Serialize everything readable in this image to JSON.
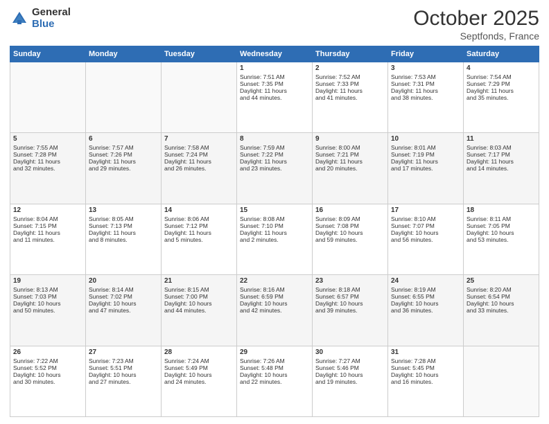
{
  "header": {
    "logo_general": "General",
    "logo_blue": "Blue",
    "month": "October 2025",
    "location": "Septfonds, France"
  },
  "weekdays": [
    "Sunday",
    "Monday",
    "Tuesday",
    "Wednesday",
    "Thursday",
    "Friday",
    "Saturday"
  ],
  "rows": [
    [
      {
        "day": "",
        "info": ""
      },
      {
        "day": "",
        "info": ""
      },
      {
        "day": "",
        "info": ""
      },
      {
        "day": "1",
        "info": "Sunrise: 7:51 AM\nSunset: 7:35 PM\nDaylight: 11 hours\nand 44 minutes."
      },
      {
        "day": "2",
        "info": "Sunrise: 7:52 AM\nSunset: 7:33 PM\nDaylight: 11 hours\nand 41 minutes."
      },
      {
        "day": "3",
        "info": "Sunrise: 7:53 AM\nSunset: 7:31 PM\nDaylight: 11 hours\nand 38 minutes."
      },
      {
        "day": "4",
        "info": "Sunrise: 7:54 AM\nSunset: 7:29 PM\nDaylight: 11 hours\nand 35 minutes."
      }
    ],
    [
      {
        "day": "5",
        "info": "Sunrise: 7:55 AM\nSunset: 7:28 PM\nDaylight: 11 hours\nand 32 minutes."
      },
      {
        "day": "6",
        "info": "Sunrise: 7:57 AM\nSunset: 7:26 PM\nDaylight: 11 hours\nand 29 minutes."
      },
      {
        "day": "7",
        "info": "Sunrise: 7:58 AM\nSunset: 7:24 PM\nDaylight: 11 hours\nand 26 minutes."
      },
      {
        "day": "8",
        "info": "Sunrise: 7:59 AM\nSunset: 7:22 PM\nDaylight: 11 hours\nand 23 minutes."
      },
      {
        "day": "9",
        "info": "Sunrise: 8:00 AM\nSunset: 7:21 PM\nDaylight: 11 hours\nand 20 minutes."
      },
      {
        "day": "10",
        "info": "Sunrise: 8:01 AM\nSunset: 7:19 PM\nDaylight: 11 hours\nand 17 minutes."
      },
      {
        "day": "11",
        "info": "Sunrise: 8:03 AM\nSunset: 7:17 PM\nDaylight: 11 hours\nand 14 minutes."
      }
    ],
    [
      {
        "day": "12",
        "info": "Sunrise: 8:04 AM\nSunset: 7:15 PM\nDaylight: 11 hours\nand 11 minutes."
      },
      {
        "day": "13",
        "info": "Sunrise: 8:05 AM\nSunset: 7:13 PM\nDaylight: 11 hours\nand 8 minutes."
      },
      {
        "day": "14",
        "info": "Sunrise: 8:06 AM\nSunset: 7:12 PM\nDaylight: 11 hours\nand 5 minutes."
      },
      {
        "day": "15",
        "info": "Sunrise: 8:08 AM\nSunset: 7:10 PM\nDaylight: 11 hours\nand 2 minutes."
      },
      {
        "day": "16",
        "info": "Sunrise: 8:09 AM\nSunset: 7:08 PM\nDaylight: 10 hours\nand 59 minutes."
      },
      {
        "day": "17",
        "info": "Sunrise: 8:10 AM\nSunset: 7:07 PM\nDaylight: 10 hours\nand 56 minutes."
      },
      {
        "day": "18",
        "info": "Sunrise: 8:11 AM\nSunset: 7:05 PM\nDaylight: 10 hours\nand 53 minutes."
      }
    ],
    [
      {
        "day": "19",
        "info": "Sunrise: 8:13 AM\nSunset: 7:03 PM\nDaylight: 10 hours\nand 50 minutes."
      },
      {
        "day": "20",
        "info": "Sunrise: 8:14 AM\nSunset: 7:02 PM\nDaylight: 10 hours\nand 47 minutes."
      },
      {
        "day": "21",
        "info": "Sunrise: 8:15 AM\nSunset: 7:00 PM\nDaylight: 10 hours\nand 44 minutes."
      },
      {
        "day": "22",
        "info": "Sunrise: 8:16 AM\nSunset: 6:59 PM\nDaylight: 10 hours\nand 42 minutes."
      },
      {
        "day": "23",
        "info": "Sunrise: 8:18 AM\nSunset: 6:57 PM\nDaylight: 10 hours\nand 39 minutes."
      },
      {
        "day": "24",
        "info": "Sunrise: 8:19 AM\nSunset: 6:55 PM\nDaylight: 10 hours\nand 36 minutes."
      },
      {
        "day": "25",
        "info": "Sunrise: 8:20 AM\nSunset: 6:54 PM\nDaylight: 10 hours\nand 33 minutes."
      }
    ],
    [
      {
        "day": "26",
        "info": "Sunrise: 7:22 AM\nSunset: 5:52 PM\nDaylight: 10 hours\nand 30 minutes."
      },
      {
        "day": "27",
        "info": "Sunrise: 7:23 AM\nSunset: 5:51 PM\nDaylight: 10 hours\nand 27 minutes."
      },
      {
        "day": "28",
        "info": "Sunrise: 7:24 AM\nSunset: 5:49 PM\nDaylight: 10 hours\nand 24 minutes."
      },
      {
        "day": "29",
        "info": "Sunrise: 7:26 AM\nSunset: 5:48 PM\nDaylight: 10 hours\nand 22 minutes."
      },
      {
        "day": "30",
        "info": "Sunrise: 7:27 AM\nSunset: 5:46 PM\nDaylight: 10 hours\nand 19 minutes."
      },
      {
        "day": "31",
        "info": "Sunrise: 7:28 AM\nSunset: 5:45 PM\nDaylight: 10 hours\nand 16 minutes."
      },
      {
        "day": "",
        "info": ""
      }
    ]
  ]
}
